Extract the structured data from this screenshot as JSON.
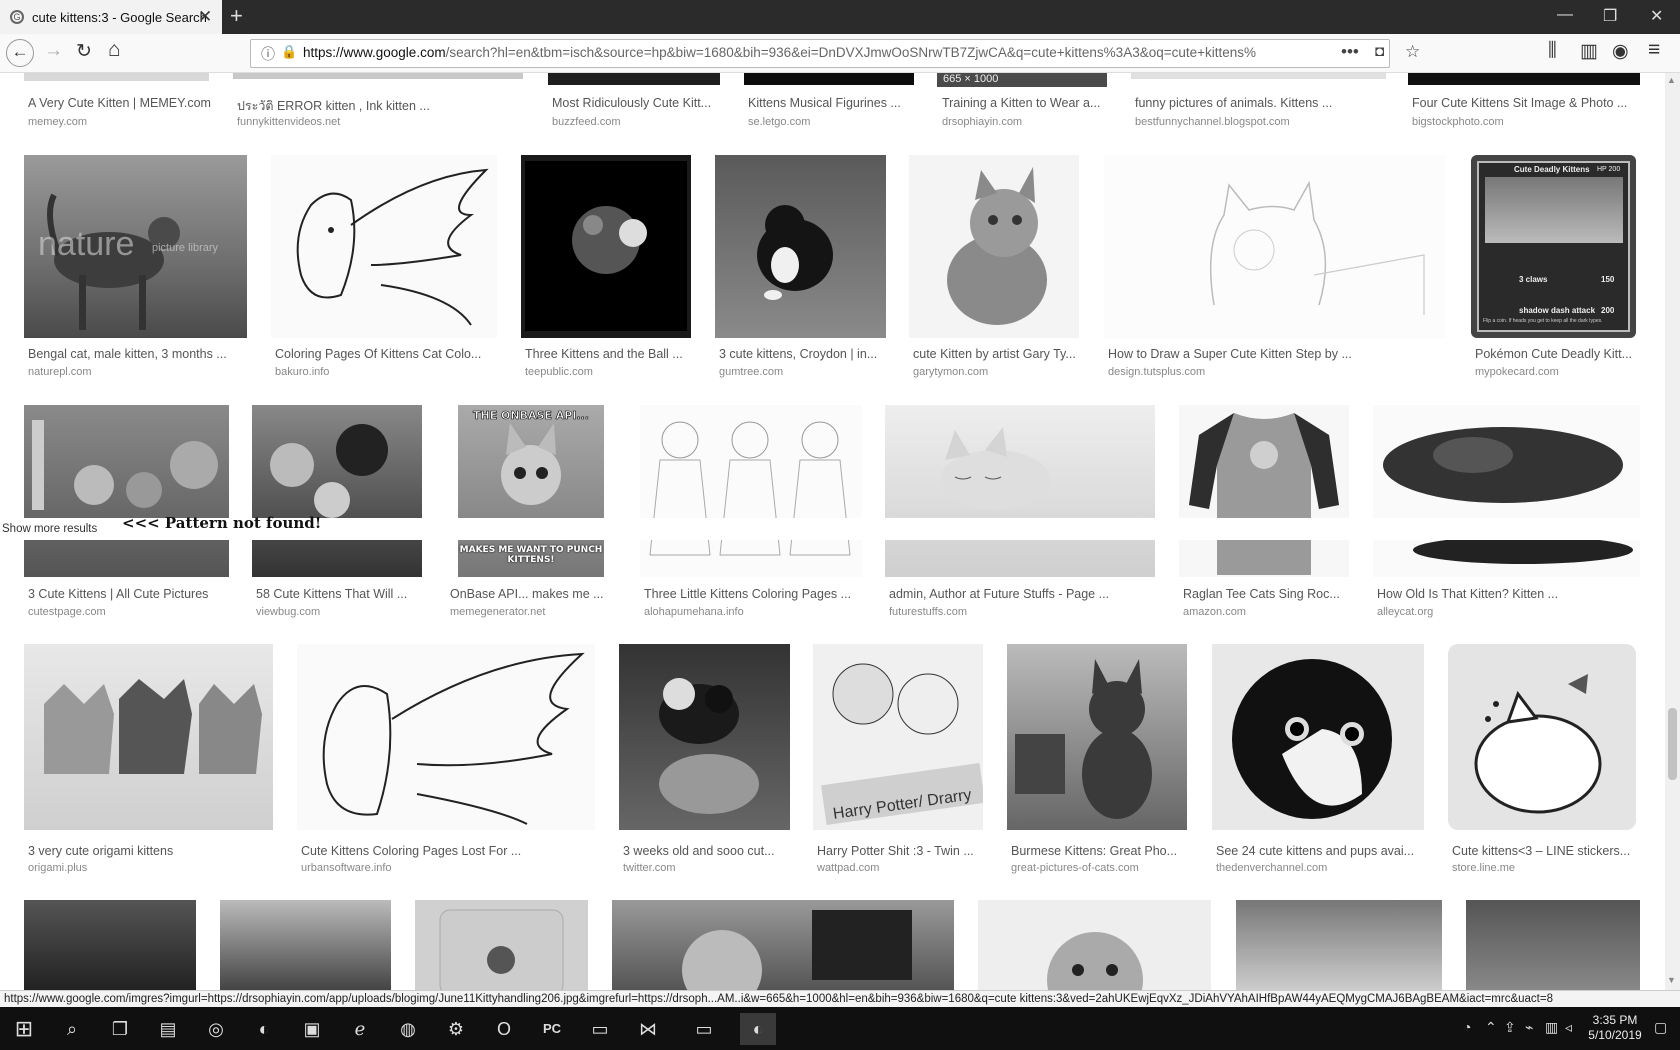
{
  "browser": {
    "tab_title": "cute kittens:3 - Google Search",
    "tab_favicon": "G",
    "url_host": "https://www.google.com",
    "url_rest": "/search?hl=en&tbm=isch&source=hp&biw=1680&bih=936&ei=DnDVXJmwOoSNrwTB7ZjwCA&q=cute+kittens%3A3&oq=cute+kittens%"
  },
  "icons": {
    "back": "←",
    "forward": "→",
    "reload": "↻",
    "home": "⌂",
    "info": "ⓘ",
    "lock": "🔒",
    "dots": "•••",
    "pocket": "◘",
    "star": "☆",
    "library": "⫼",
    "sidebar": "▥",
    "account": "◉",
    "menu": "≡",
    "close": "✕",
    "newtab": "+",
    "minimize": "—",
    "maximize": "❐"
  },
  "row0": [
    {
      "caption": "A Very Cute Kitten | MEMEY.com",
      "domain": "memey.com"
    },
    {
      "caption": "ประวัติ ERROR kitten , Ink kitten ...",
      "domain": "funnykittenvideos.net"
    },
    {
      "caption": "Most Ridiculously Cute Kitt...",
      "domain": "buzzfeed.com"
    },
    {
      "caption": "Kittens Musical Figurines ...",
      "domain": "se.letgo.com"
    },
    {
      "caption": "Training a Kitten to Wear a...",
      "domain": "drsophiayin.com"
    },
    {
      "caption": "funny pictures of animals. Kittens ...",
      "domain": "bestfunnychannel.blogspot.com"
    },
    {
      "caption": "Four Cute Kittens Sit Image & Photo ...",
      "domain": "bigstockphoto.com"
    }
  ],
  "dim_badge": "665 × 1000",
  "row1": [
    {
      "caption": "Bengal cat, male kitten, 3 months ...",
      "domain": "naturepl.com"
    },
    {
      "caption": "Coloring Pages Of Kittens Cat Colo...",
      "domain": "bakuro.info"
    },
    {
      "caption": "Three Kittens and the Ball ...",
      "domain": "teepublic.com"
    },
    {
      "caption": "3 cute kittens, Croydon | in...",
      "domain": "gumtree.com"
    },
    {
      "caption": "cute Kitten by artist Gary Ty...",
      "domain": "garytymon.com"
    },
    {
      "caption": "How to Draw a Super Cute Kitten Step by ...",
      "domain": "design.tutsplus.com"
    },
    {
      "caption": "Pokémon Cute Deadly Kitt...",
      "domain": "mypokecard.com"
    }
  ],
  "card": {
    "name": "Cute Deadly Kittens",
    "hp": "HP 200",
    "atk1": "3 claws",
    "atk1_dmg": "150",
    "atk2": "shadow dash attack",
    "atk2_dmg": "200",
    "rule": "Flip a coin. If heads you get to keep all the dark types."
  },
  "watermark": "nature",
  "watermark_small": "picture library",
  "row2": [
    {
      "caption": "3 Cute Kittens | All Cute Pictures",
      "domain": "cutestpage.com"
    },
    {
      "caption": "58 Cute Kittens That Will ...",
      "domain": "viewbug.com"
    },
    {
      "caption": "OnBase API... makes me ...",
      "domain": "memegenerator.net"
    },
    {
      "caption": "Three Little Kittens Coloring Pages ...",
      "domain": "alohapumehana.info"
    },
    {
      "caption": "admin, Author at Future Stuffs - Page ...",
      "domain": "futurestuffs.com"
    },
    {
      "caption": "Raglan Tee Cats Sing Roc...",
      "domain": "amazon.com"
    },
    {
      "caption": "How Old Is That Kitten? Kitten ...",
      "domain": "alleycat.org"
    }
  ],
  "meme_top": "THE ONBASE API...",
  "meme_bottom": "MAKES ME WANT TO PUNCH KITTENS!",
  "show_more": "Show more results",
  "pattern_msg": "<<< Pattern not found!",
  "row3": [
    {
      "caption": "3 very cute origami kittens",
      "domain": "origami.plus"
    },
    {
      "caption": "Cute Kittens Coloring Pages Lost For ...",
      "domain": "urbansoftware.info"
    },
    {
      "caption": "3 weeks old and sooo cut...",
      "domain": "twitter.com"
    },
    {
      "caption": "Harry Potter Shit :3 - Twin ...",
      "domain": "wattpad.com"
    },
    {
      "caption": "Burmese Kittens: Great Pho...",
      "domain": "great-pictures-of-cats.com"
    },
    {
      "caption": "See 24 cute kittens and pups avai...",
      "domain": "thedenverchannel.com"
    },
    {
      "caption": "Cute kittens<3 – LINE stickers...",
      "domain": "store.line.me"
    }
  ],
  "hp_banner": "Harry Potter/ Drarry",
  "status_url": "https://www.google.com/imgres?imgurl=https://drsophiayin.com/app/uploads/blogimg/June11Kittyhandling206.jpg&imgrefurl=https://drsoph...AM..i&w=665&h=1000&hl=en&bih=936&biw=1680&q=cute kittens:3&ved=2ahUKEwjEqvXz_JDiAhVYAhAIHfBpAW44yAEQMygCMAJ6BAgBEAM&iact=mrc&uact=8",
  "clock": {
    "time": "3:35 PM",
    "date": "5/10/2019"
  }
}
